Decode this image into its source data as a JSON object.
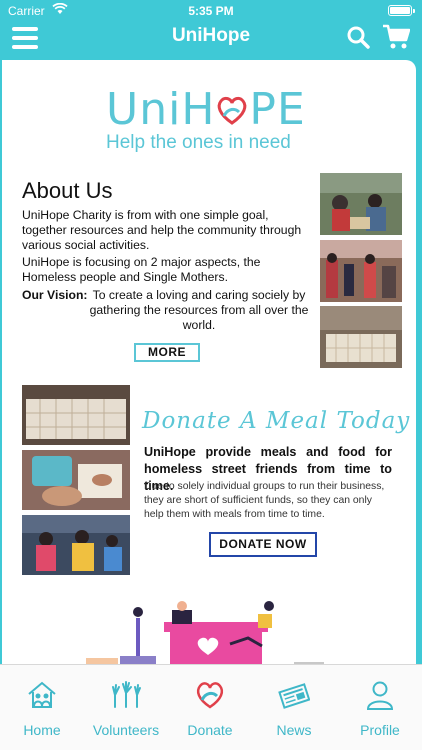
{
  "status_bar": {
    "carrier": "Carrier",
    "time": "5:35 PM"
  },
  "nav": {
    "title": "UniHope"
  },
  "logo": {
    "wordmark": "UniHOPE",
    "word_left": "UniH",
    "word_right": "PE",
    "tagline": "Help the ones in need"
  },
  "about": {
    "title": "About Us",
    "paragraph1": "UniHope Charity is from with one simple goal, together resources and help the community through various social activities.",
    "paragraph2": "UniHope is focusing on 2 major aspects, the Homeless people and Single Mothers.",
    "vision_label": "Our Vision:",
    "vision_text": "To create a loving and caring sociely by gathering the resources from all over the world.",
    "more_button": "MORE"
  },
  "donate": {
    "title": "Donate A Meal Today",
    "lead": "UniHope provide meals and food for homeless street friends from time to time.",
    "sub": "Due to solely individual groups to run their business, they are short of sufficient funds, so they can only help them with meals from time to time.",
    "button": "DONATE NOW"
  },
  "tabs": [
    {
      "label": "Home",
      "icon": "home-people-icon"
    },
    {
      "label": "Volunteers",
      "icon": "raised-hands-icon"
    },
    {
      "label": "Donate",
      "icon": "heart-hands-icon"
    },
    {
      "label": "News",
      "icon": "newspaper-icon"
    },
    {
      "label": "Profile",
      "icon": "person-icon"
    }
  ],
  "colors": {
    "brand": "#3fc9d6",
    "accent_red": "#e0404a",
    "button_blue_border": "#2346a8"
  }
}
